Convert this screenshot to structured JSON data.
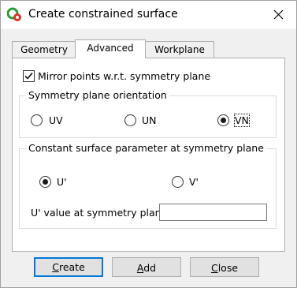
{
  "window": {
    "title": "Create constrained surface"
  },
  "tabs": [
    {
      "label": "Geometry"
    },
    {
      "label": "Advanced",
      "active": true
    },
    {
      "label": "Workplane"
    }
  ],
  "mirror": {
    "label": "Mirror points w.r.t. symmetry plane",
    "checked": true
  },
  "orientation_group": {
    "title": "Symmetry plane orientation",
    "options": [
      {
        "label": "UV",
        "selected": false
      },
      {
        "label": "UN",
        "selected": false
      },
      {
        "label": "VN",
        "selected": true
      }
    ]
  },
  "constant_group": {
    "title": "Constant surface parameter at symmetry plane",
    "options": [
      {
        "label": "U'",
        "selected": true
      },
      {
        "label": "V'",
        "selected": false
      }
    ],
    "value_label": "U' value at symmetry plane",
    "value": ""
  },
  "buttons": {
    "create": {
      "first": "C",
      "rest": "reate"
    },
    "add": {
      "first": "A",
      "rest": "dd"
    },
    "close": {
      "first": "C",
      "rest": "lose"
    }
  },
  "colors": {
    "accent": "#0078d7",
    "title_bg": "#ffffff",
    "dialog_bg": "#f0f0f0"
  },
  "icons": {
    "app": "constrained-surface-app-icon",
    "close": "close-icon",
    "check": "checkmark-icon"
  }
}
